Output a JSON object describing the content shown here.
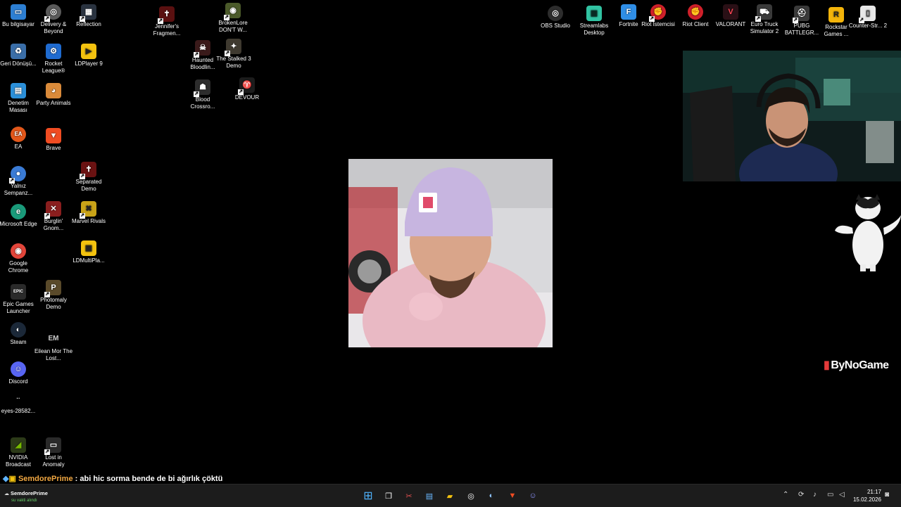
{
  "desktop_icons": [
    {
      "label": "Bu bilgisayar",
      "icon": "computer-icon",
      "color": "#2d7fd3",
      "glyph": "▭"
    },
    {
      "label": "Delivery & Beyond",
      "icon": "delivery-game-icon",
      "color": "#5a5a5a",
      "glyph": "◎"
    },
    {
      "label": "Reflection",
      "icon": "reflection-game-icon",
      "color": "#2a3340",
      "glyph": "▦"
    },
    {
      "label": "Jennifer's Fragmen...",
      "icon": "jennifer-game-icon",
      "color": "#5a1010",
      "glyph": "✝"
    },
    {
      "label": "BrokenLore DON'T W...",
      "icon": "brokenlore-game-icon",
      "color": "#4b5a2a",
      "glyph": "◉"
    },
    {
      "label": "Geri Dönüşü...",
      "icon": "recycle-bin-icon",
      "color": "#3a6ea8",
      "glyph": "♻"
    },
    {
      "label": "Rocket League®",
      "icon": "rocket-league-icon",
      "color": "#1f6bd0",
      "glyph": "⚙"
    },
    {
      "label": "LDPlayer 9",
      "icon": "ldplayer-icon",
      "color": "#f3c20f",
      "glyph": "▶"
    },
    {
      "label": "Haunted Bloodlin...",
      "icon": "haunted-game-icon",
      "color": "#3a1a1a",
      "glyph": "☠"
    },
    {
      "label": "The Stalked 3 Demo",
      "icon": "stalked-game-icon",
      "color": "#3f3a30",
      "glyph": "✦"
    },
    {
      "label": "Denetim Masası",
      "icon": "control-panel-icon",
      "color": "#2b8fd8",
      "glyph": "▤"
    },
    {
      "label": "Party Animals",
      "icon": "party-animals-icon",
      "color": "#d98a3a",
      "glyph": "◕"
    },
    {
      "label": "Blood Crossro...",
      "icon": "blood-crossroads-icon",
      "color": "#2d2d2d",
      "glyph": "☗"
    },
    {
      "label": "DEVOUR",
      "icon": "devour-game-icon",
      "color": "#1c1c1c",
      "glyph": "♈"
    },
    {
      "label": "EA",
      "icon": "ea-icon",
      "color": "#e2571a",
      "glyph": "EA"
    },
    {
      "label": "Brave",
      "icon": "brave-browser-icon",
      "color": "#f04c22",
      "glyph": "▼"
    },
    {
      "label": "Yalnız Sempanz...",
      "icon": "chrome-profile-icon",
      "color": "#3a7bd5",
      "glyph": "●"
    },
    {
      "label": "Separated Demo",
      "icon": "separated-game-icon",
      "color": "#6a1212",
      "glyph": "✝"
    },
    {
      "label": "Microsoft Edge",
      "icon": "edge-browser-icon",
      "color": "#1a9a7a",
      "glyph": "e"
    },
    {
      "label": "Burglin' Gnom...",
      "icon": "burglin-gnomes-icon",
      "color": "#8a1e1e",
      "glyph": "✕"
    },
    {
      "label": "Marvel Rivals",
      "icon": "marvel-rivals-icon",
      "color": "#c9a318",
      "glyph": "✖"
    },
    {
      "label": "Google Chrome",
      "icon": "chrome-icon",
      "color": "#e2453a",
      "glyph": "◉"
    },
    {
      "label": "LDMultiPla...",
      "icon": "ldmultiplayer-icon",
      "color": "#f3c20f",
      "glyph": "▣"
    },
    {
      "label": "Epic Games Launcher",
      "icon": "epic-games-icon",
      "color": "#2a2a2a",
      "glyph": "EPIC"
    },
    {
      "label": "Photomaly Demo",
      "icon": "photomaly-icon",
      "color": "#5a4a2a",
      "glyph": "P"
    },
    {
      "label": "Steam",
      "icon": "steam-icon",
      "color": "#1b2838",
      "glyph": "◐"
    },
    {
      "label": "Eilean Mor The Lost...",
      "icon": "eilean-mor-icon",
      "color": "#000000",
      "glyph": "EM"
    },
    {
      "label": "Discord",
      "icon": "discord-icon",
      "color": "#5865f2",
      "glyph": "☺"
    },
    {
      "label": "eyes-28582...",
      "icon": "file-icon",
      "color": "#000000",
      "glyph": "··"
    },
    {
      "label": "NVIDIA Broadcast",
      "icon": "nvidia-broadcast-icon",
      "color": "#2c3a18",
      "glyph": "◢"
    },
    {
      "label": "Lost in Anomaly",
      "icon": "lost-in-anomaly-icon",
      "color": "#2a2a2a",
      "glyph": "▭"
    },
    {
      "label": "OBS Studio",
      "icon": "obs-studio-icon",
      "color": "#2d2d2d",
      "glyph": "◎"
    },
    {
      "label": "Streamlabs Desktop",
      "icon": "streamlabs-icon",
      "color": "#31c3a2",
      "glyph": "▣"
    },
    {
      "label": "Fortnite",
      "icon": "fortnite-icon",
      "color": "#2f8ee6",
      "glyph": "F"
    },
    {
      "label": "Riot İstemcisi",
      "icon": "riot-client-icon",
      "color": "#d0202a",
      "glyph": "✊"
    },
    {
      "label": "Riot Client",
      "icon": "riot-client-alt-icon",
      "color": "#d0202a",
      "glyph": "✊"
    },
    {
      "label": "VALORANT",
      "icon": "valorant-icon",
      "color": "#2a1016",
      "glyph": "V"
    },
    {
      "label": "Euro Truck Simulator 2",
      "icon": "euro-truck-icon",
      "color": "#3a3a3a",
      "glyph": "⛟"
    },
    {
      "label": "PUBG BATTLEGR...",
      "icon": "pubg-icon",
      "color": "#3a3a3a",
      "glyph": "⛑"
    },
    {
      "label": "Rockstar Games ...",
      "icon": "rockstar-games-icon",
      "color": "#f3b40a",
      "glyph": "R"
    },
    {
      "label": "Counter-Str... 2",
      "icon": "counter-strike-icon",
      "color": "#e8e8e8",
      "glyph": "▯"
    }
  ],
  "overlay": {
    "brand": "ByNoGame",
    "chat_user": "SemdorePrime",
    "chat_separator": " : ",
    "chat_message": "abi hic sorma bende de bi ağırlık çöktü"
  },
  "taskbar": {
    "profile_name": "SemdorePrime",
    "profile_status": "su vakti alındı",
    "time": "21:17",
    "date": "15.02.2026"
  }
}
